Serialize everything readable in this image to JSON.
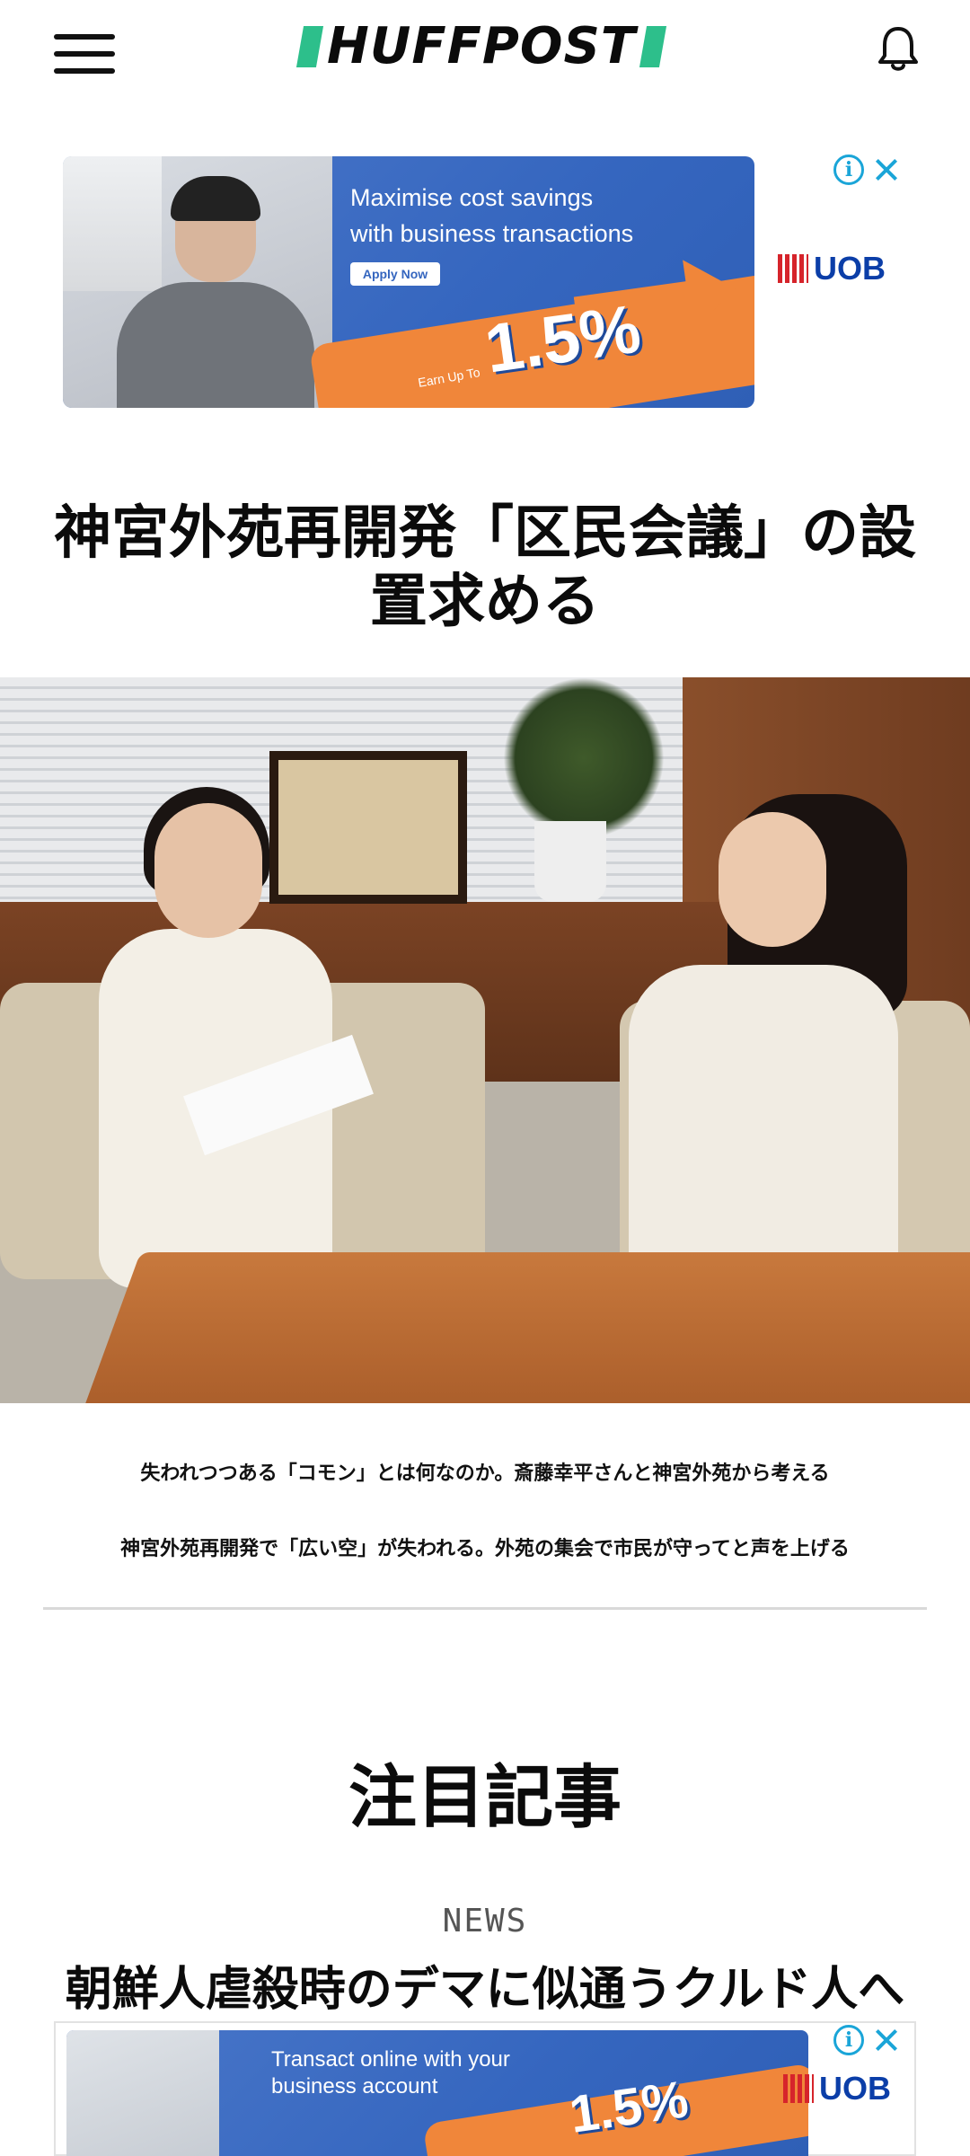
{
  "header": {
    "logo_text": "HUFFPOST",
    "menu_icon": "hamburger-menu-icon",
    "notification_icon": "bell-icon",
    "brand_color": "#2dbf8b"
  },
  "ad_top": {
    "headline_line1": "Maximise cost savings",
    "headline_line2": "with business transactions",
    "cta": "Apply Now",
    "rate": "1.5%",
    "earn": "Earn Up To",
    "brand": "UOB",
    "info_icon": "info-icon",
    "close_icon": "close-icon"
  },
  "article": {
    "headline": "神宮外苑再開発「区民会議」の設置求める"
  },
  "related_links": [
    "失われつつある「コモン」とは何なのか。斎藤幸平さんと神宮外苑から考える",
    "神宮外苑再開発で「広い空」が失われる。外苑の集会で市民が守ってと声を上げる"
  ],
  "featured": {
    "section_title": "注目記事",
    "kicker": "NEWS",
    "article_title": "朝鮮人虐殺時のデマに似通うクルド人へ"
  },
  "ad_bottom": {
    "headline_line1": "Transact online with your",
    "headline_line2": "business account",
    "rate": "1.5%",
    "brand": "UOB",
    "info_icon": "info-icon",
    "close_icon": "close-icon"
  }
}
